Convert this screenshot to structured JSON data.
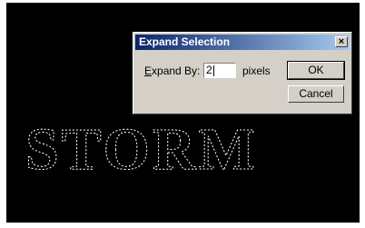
{
  "canvas": {
    "text": "STORM"
  },
  "dialog": {
    "title": "Expand Selection",
    "close_glyph": "×",
    "expand_label_prefix": "E",
    "expand_label_rest": "xpand By:",
    "expand_value": "2",
    "unit": "pixels",
    "ok_label": "OK",
    "cancel_label": "Cancel"
  }
}
